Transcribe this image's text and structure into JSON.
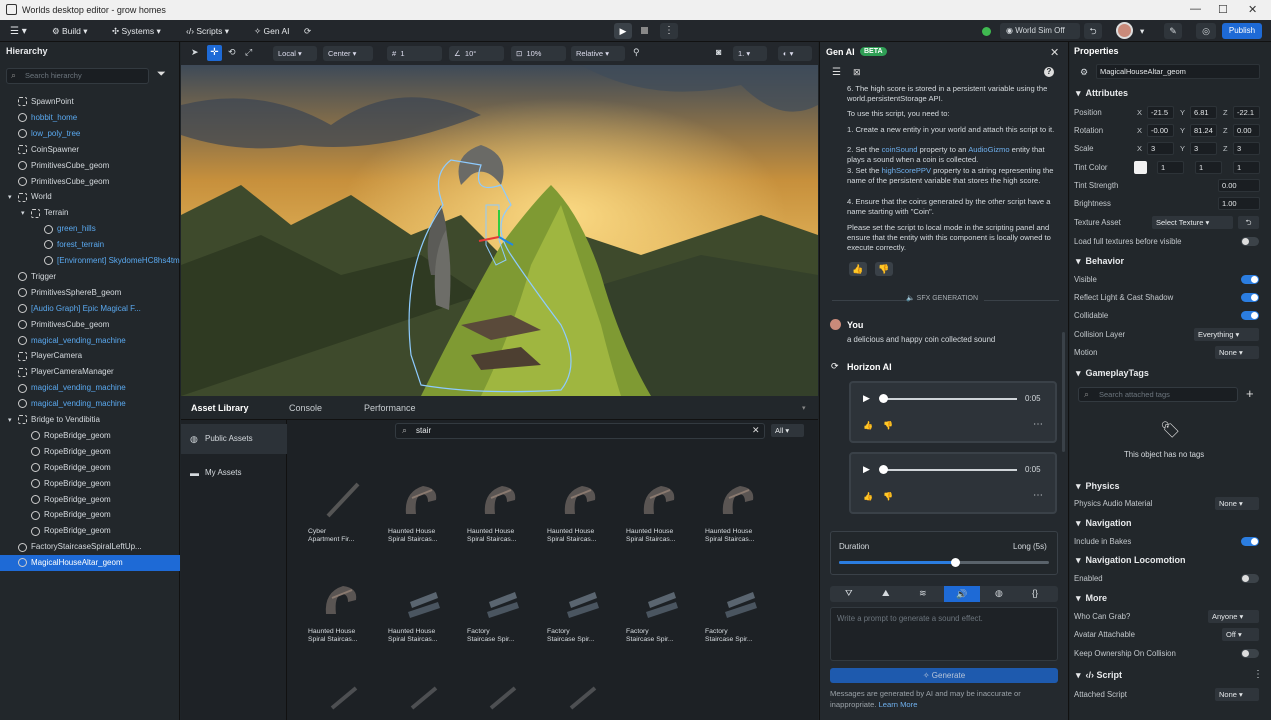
{
  "window": {
    "title": "Worlds desktop editor - grow homes"
  },
  "menu": {
    "build": "Build",
    "systems": "Systems",
    "scripts": "Scripts",
    "genai": "Gen AI",
    "world_sim": "World Sim Off",
    "publish": "Publish"
  },
  "hierarchy": {
    "title": "Hierarchy",
    "search_placeholder": "Search hierarchy",
    "items": [
      {
        "label": "SpawnPoint",
        "blue": false
      },
      {
        "label": "hobbit_home",
        "blue": true
      },
      {
        "label": "low_poly_tree",
        "blue": true
      },
      {
        "label": "CoinSpawner",
        "blue": false
      },
      {
        "label": "PrimitivesCube_geom",
        "blue": false
      },
      {
        "label": "PrimitivesCube_geom",
        "blue": false
      },
      {
        "label": "World",
        "blue": false
      },
      {
        "label": "Terrain",
        "blue": false
      },
      {
        "label": "green_hills",
        "blue": true
      },
      {
        "label": "forest_terrain",
        "blue": true
      },
      {
        "label": "[Environment] SkydomeHC8hs4tmrachaufs",
        "blue": true
      },
      {
        "label": "Trigger",
        "blue": false
      },
      {
        "label": "PrimitivesSphereB_geom",
        "blue": false
      },
      {
        "label": "[Audio Graph] Epic Magical F...",
        "blue": true
      },
      {
        "label": "PrimitivesCube_geom",
        "blue": false
      },
      {
        "label": "magical_vending_machine",
        "blue": true
      },
      {
        "label": "PlayerCamera",
        "blue": false
      },
      {
        "label": "PlayerCameraManager",
        "blue": false
      },
      {
        "label": "magical_vending_machine",
        "blue": true
      },
      {
        "label": "magical_vending_machine",
        "blue": true
      },
      {
        "label": "Bridge to Vendibitia",
        "blue": false
      },
      {
        "label": "RopeBridge_geom",
        "blue": false
      },
      {
        "label": "RopeBridge_geom",
        "blue": false
      },
      {
        "label": "RopeBridge_geom",
        "blue": false
      },
      {
        "label": "RopeBridge_geom",
        "blue": false
      },
      {
        "label": "RopeBridge_geom",
        "blue": false
      },
      {
        "label": "RopeBridge_geom",
        "blue": false
      },
      {
        "label": "RopeBridge_geom",
        "blue": false
      },
      {
        "label": "FactoryStaircaseSpiralLeftUp...",
        "blue": false
      },
      {
        "label": "MagicalHouseAltar_geom",
        "blue": false
      }
    ]
  },
  "toolbar": {
    "local": "Local",
    "center": "Center",
    "grid": "1",
    "angle": "10°",
    "scale": "10%",
    "relative": "Relative",
    "cam": "1."
  },
  "bottom": {
    "tabs": [
      "Asset Library",
      "Console",
      "Performance"
    ],
    "search": "stair",
    "filter": "All",
    "side": [
      "Public Assets",
      "My Assets"
    ],
    "assets": [
      [
        "Cyber",
        "Apartment Fir..."
      ],
      [
        "Haunted House",
        "Spiral Staircas..."
      ],
      [
        "Haunted House",
        "Spiral Staircas..."
      ],
      [
        "Haunted House",
        "Spiral Staircas..."
      ],
      [
        "Haunted House",
        "Spiral Staircas..."
      ],
      [
        "Haunted House",
        "Spiral Staircas..."
      ],
      [
        "Haunted House",
        "Spiral Staircas..."
      ],
      [
        "Haunted House",
        "Spiral Staircas..."
      ],
      [
        "Factory",
        "Staircase Spir..."
      ],
      [
        "Factory",
        "Staircase Spir..."
      ],
      [
        "Factory",
        "Staircase Spir..."
      ],
      [
        "Factory",
        "Staircase Spir..."
      ]
    ]
  },
  "genai": {
    "title": "Gen AI",
    "beta": "BETA",
    "p1": "6. The high score is stored in a persistent variable using the world.persistentStorage API.",
    "p2": "To use this script, you need to:",
    "p3": "1. Create a new entity in your world and attach this script to it.",
    "p4a": "2. Set the ",
    "p4b": "coinSound",
    "p4c": " property to an ",
    "p4d": "AudioGizmo",
    "p4e": " entity that plays a sound when a coin is collected.",
    "p5a": "3. Set the ",
    "p5b": "highScorePPV",
    "p5c": " property to a string representing the name of the persistent variable that stores the high score.",
    "p6": "4. Ensure that the coins generated by the other script have a name starting with \"Coin\".",
    "p7": "Please set the script to local mode in the scripting panel and ensure that the entity with this component is locally owned to execute correctly.",
    "sfx": "SFX GENERATION",
    "you": "You",
    "prompt_text": "a delicious and happy coin collected sound",
    "horizon": "Horizon AI",
    "time1": "0:05",
    "time2": "0:05",
    "duration": "Duration",
    "duration_val": "Long (5s)",
    "placeholder": "Write a prompt to generate a sound effect.",
    "generate": "Generate",
    "disclaimer": "Messages are generated by AI and may be inaccurate or inappropriate.",
    "learn": "Learn More",
    "slider_fraction": 0.55
  },
  "props": {
    "title": "Properties",
    "name": "MagicalHouseAltar_geom",
    "attributes": "Attributes",
    "position": {
      "label": "Position",
      "x": "-21.5",
      "y": "6.81",
      "z": "-22.1"
    },
    "rotation": {
      "label": "Rotation",
      "x": "-0.00",
      "y": "81.24",
      "z": "0.00"
    },
    "scale": {
      "label": "Scale",
      "x": "3",
      "y": "3",
      "z": "3"
    },
    "tint_color": {
      "label": "Tint Color",
      "r": "1",
      "g": "1",
      "b": "1"
    },
    "tint_strength": {
      "label": "Tint Strength",
      "v": "0.00"
    },
    "brightness": {
      "label": "Brightness",
      "v": "1.00"
    },
    "texture": {
      "label": "Texture Asset",
      "v": "Select Texture"
    },
    "load_full": "Load full textures before visible",
    "behavior": "Behavior",
    "visible": "Visible",
    "reflect": "Reflect Light & Cast Shadow",
    "collidable": "Collidable",
    "collision_layer": "Collision Layer",
    "collision_val": "Everything",
    "motion": "Motion",
    "motion_val": "None",
    "gameplay": "GameplayTags",
    "tags_search": "Search attached tags",
    "no_tags": "This object has no tags",
    "physics": "Physics",
    "phys_audio": "Physics Audio Material",
    "phys_val": "None",
    "navigation": "Navigation",
    "include_bakes": "Include in Bakes",
    "nav_loco": "Navigation Locomotion",
    "enabled": "Enabled",
    "more": "More",
    "who_grab": "Who Can Grab?",
    "who_val": "Anyone",
    "avatar_att": "Avatar Attachable",
    "avatar_val": "Off",
    "keep_own": "Keep Ownership On Collision",
    "script": "Script",
    "attached": "Attached Script",
    "attached_val": "None"
  }
}
